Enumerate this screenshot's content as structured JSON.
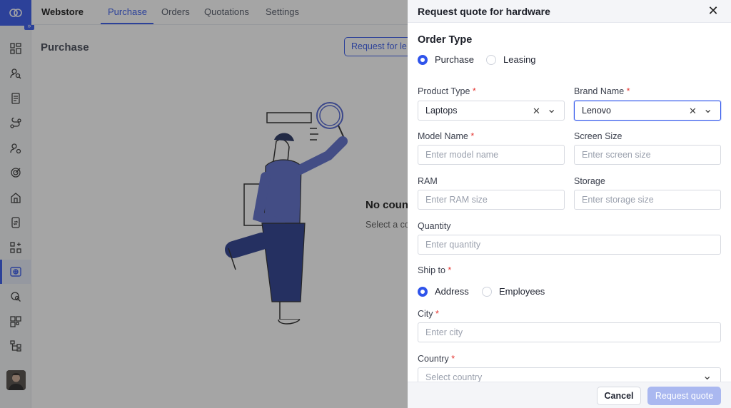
{
  "rail": {
    "icons": [
      "cloud-logo-icon",
      "expand-icon",
      "dashboard-icon",
      "user-search-icon",
      "document-icon",
      "route-icon",
      "user-settings-icon",
      "target-icon",
      "building-icon",
      "device-sync-icon",
      "apps-add-icon",
      "webstore-icon",
      "chat-search-icon",
      "widgets-icon",
      "hierarchy-icon"
    ],
    "expand_glyph": "»"
  },
  "topnav": {
    "brand": "Webstore",
    "tabs": [
      {
        "label": "Purchase",
        "active": true
      },
      {
        "label": "Orders",
        "active": false
      },
      {
        "label": "Quotations",
        "active": false
      },
      {
        "label": "Settings",
        "active": false
      }
    ]
  },
  "content": {
    "title": "Purchase",
    "request_button": "Request for le",
    "empty_title": "No coun",
    "empty_sub": "Select a co"
  },
  "drawer": {
    "title": "Request quote for hardware",
    "close_glyph": "✕",
    "order_type": {
      "title": "Order Type",
      "options": [
        {
          "label": "Purchase",
          "checked": true
        },
        {
          "label": "Leasing",
          "checked": false
        }
      ]
    },
    "product_type": {
      "label": "Product Type",
      "required": "*",
      "value": "Laptops"
    },
    "brand_name": {
      "label": "Brand Name",
      "required": "*",
      "value": "Lenovo"
    },
    "model_name": {
      "label": "Model Name",
      "required": "*",
      "placeholder": "Enter model name"
    },
    "screen_size": {
      "label": "Screen Size",
      "placeholder": "Enter screen size"
    },
    "ram": {
      "label": "RAM",
      "placeholder": "Enter RAM size"
    },
    "storage": {
      "label": "Storage",
      "placeholder": "Enter storage size"
    },
    "quantity": {
      "label": "Quantity",
      "placeholder": "Enter quantity"
    },
    "ship_to": {
      "label": "Ship to",
      "required": "*",
      "options": [
        {
          "label": "Address",
          "checked": true
        },
        {
          "label": "Employees",
          "checked": false
        }
      ]
    },
    "city": {
      "label": "City",
      "required": "*",
      "placeholder": "Enter city"
    },
    "country": {
      "label": "Country",
      "required": "*",
      "placeholder": "Select country"
    },
    "clear_glyph": "✕",
    "chevron_glyph": "⌄",
    "footer": {
      "cancel": "Cancel",
      "submit": "Request quote"
    }
  },
  "colors": {
    "accent": "#2f54eb",
    "required": "#e53935",
    "overlay": "rgba(40,40,40,0.42)"
  }
}
